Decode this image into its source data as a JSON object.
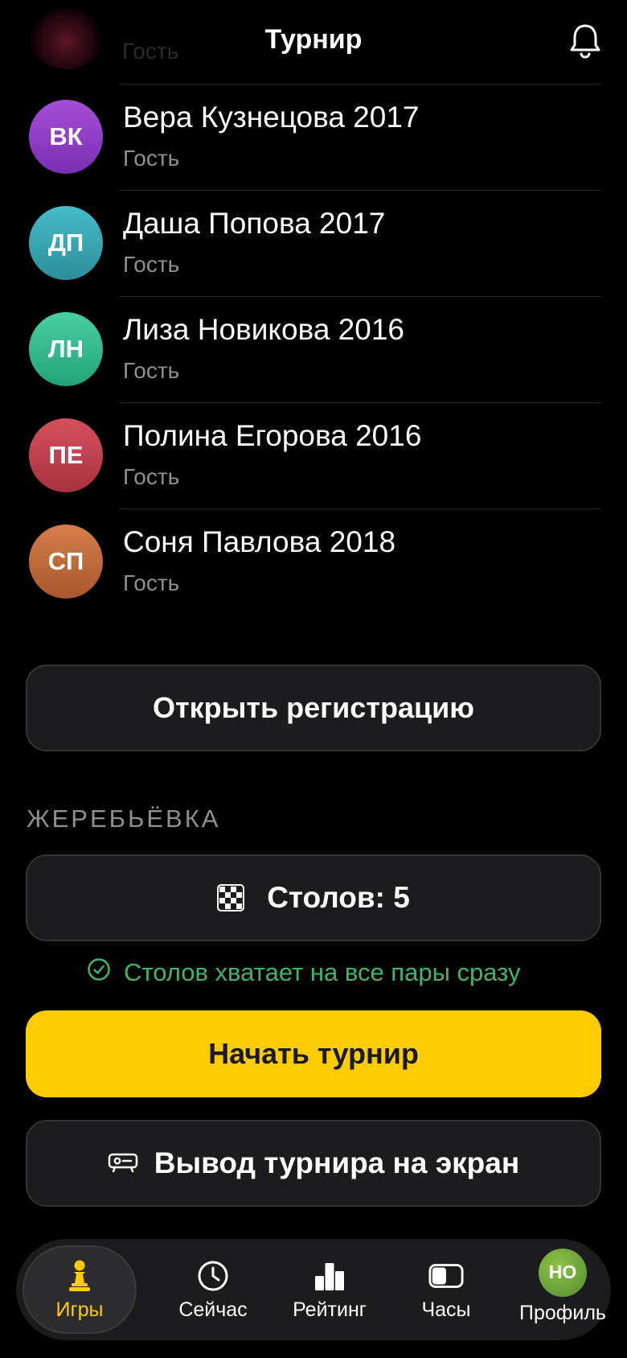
{
  "header": {
    "title": "Турнир",
    "ghost_text": "Гость"
  },
  "players": [
    {
      "initials": "ВК",
      "name": "Вера Кузнецова 2017",
      "role": "Гость",
      "color_top": "#a64dd8",
      "color_bottom": "#7a2fb3"
    },
    {
      "initials": "ДП",
      "name": "Даша Попова 2017",
      "role": "Гость",
      "color_top": "#46bcc9",
      "color_bottom": "#2a8f9b"
    },
    {
      "initials": "ЛН",
      "name": "Лиза Новикова 2016",
      "role": "Гость",
      "color_top": "#49cfa0",
      "color_bottom": "#23a37a"
    },
    {
      "initials": "ПЕ",
      "name": "Полина Егорова 2016",
      "role": "Гость",
      "color_top": "#d6505f",
      "color_bottom": "#a8323f"
    },
    {
      "initials": "СП",
      "name": "Соня Павлова 2018",
      "role": "Гость",
      "color_top": "#d57e4b",
      "color_bottom": "#a8582d"
    }
  ],
  "actions": {
    "open_registration": "Открыть регистрацию",
    "draw_section": "ЖЕРЕБЬЁВКА",
    "tables_label": "Столов: 5",
    "tables_hint": "Столов хватает на все пары сразу",
    "start_tournament": "Начать турнир",
    "show_on_screen": "Вывод турнира на экран"
  },
  "tabbar": {
    "games": "Игры",
    "now": "Сейчас",
    "rating": "Рейтинг",
    "clock": "Часы",
    "profile": "Профиль",
    "profile_initials": "НО"
  },
  "colors": {
    "accent": "#ffcc00",
    "success": "#3fb46c",
    "muted": "#8e8e93",
    "surface": "#1c1c1e"
  }
}
